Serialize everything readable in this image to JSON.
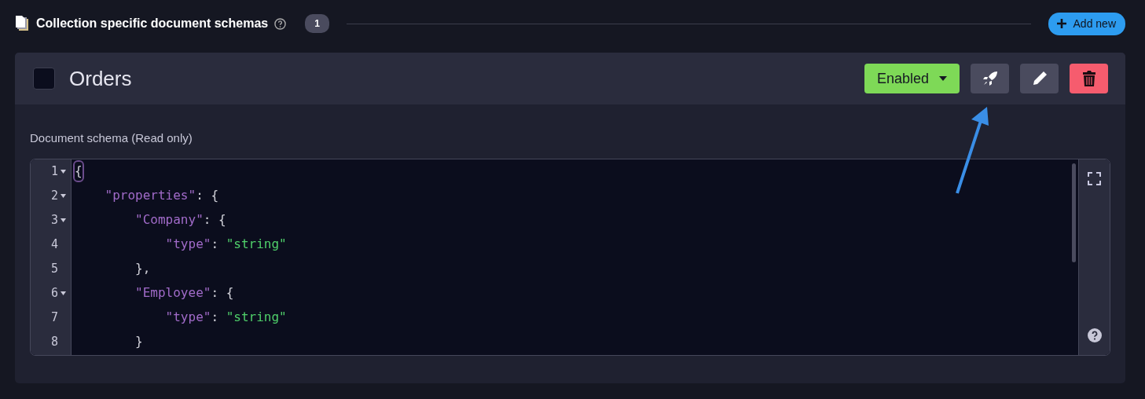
{
  "section": {
    "title": "Collection specific document schemas",
    "count": "1",
    "add_button": "Add new"
  },
  "schema": {
    "name": "Orders",
    "checked": false,
    "status": "Enabled",
    "label": "Document schema (Read only)",
    "code": [
      {
        "number": "1",
        "foldable": true,
        "tokens": [
          {
            "kind": "bracket",
            "text": "{"
          }
        ]
      },
      {
        "number": "2",
        "foldable": true,
        "tokens": [
          {
            "kind": "key",
            "text": "    \"properties\""
          },
          {
            "kind": "punct",
            "text": ": {"
          }
        ]
      },
      {
        "number": "3",
        "foldable": true,
        "tokens": [
          {
            "kind": "key",
            "text": "        \"Company\""
          },
          {
            "kind": "punct",
            "text": ": {"
          }
        ]
      },
      {
        "number": "4",
        "foldable": false,
        "tokens": [
          {
            "kind": "key",
            "text": "            \"type\""
          },
          {
            "kind": "punct",
            "text": ": "
          },
          {
            "kind": "string",
            "text": "\"string\""
          }
        ]
      },
      {
        "number": "5",
        "foldable": false,
        "tokens": [
          {
            "kind": "punct",
            "text": "        },"
          }
        ]
      },
      {
        "number": "6",
        "foldable": true,
        "tokens": [
          {
            "kind": "key",
            "text": "        \"Employee\""
          },
          {
            "kind": "punct",
            "text": ": {"
          }
        ]
      },
      {
        "number": "7",
        "foldable": false,
        "tokens": [
          {
            "kind": "key",
            "text": "            \"type\""
          },
          {
            "kind": "punct",
            "text": ": "
          },
          {
            "kind": "string",
            "text": "\"string\""
          }
        ]
      },
      {
        "number": "8",
        "foldable": false,
        "tokens": [
          {
            "kind": "punct",
            "text": "        }"
          }
        ]
      }
    ]
  }
}
